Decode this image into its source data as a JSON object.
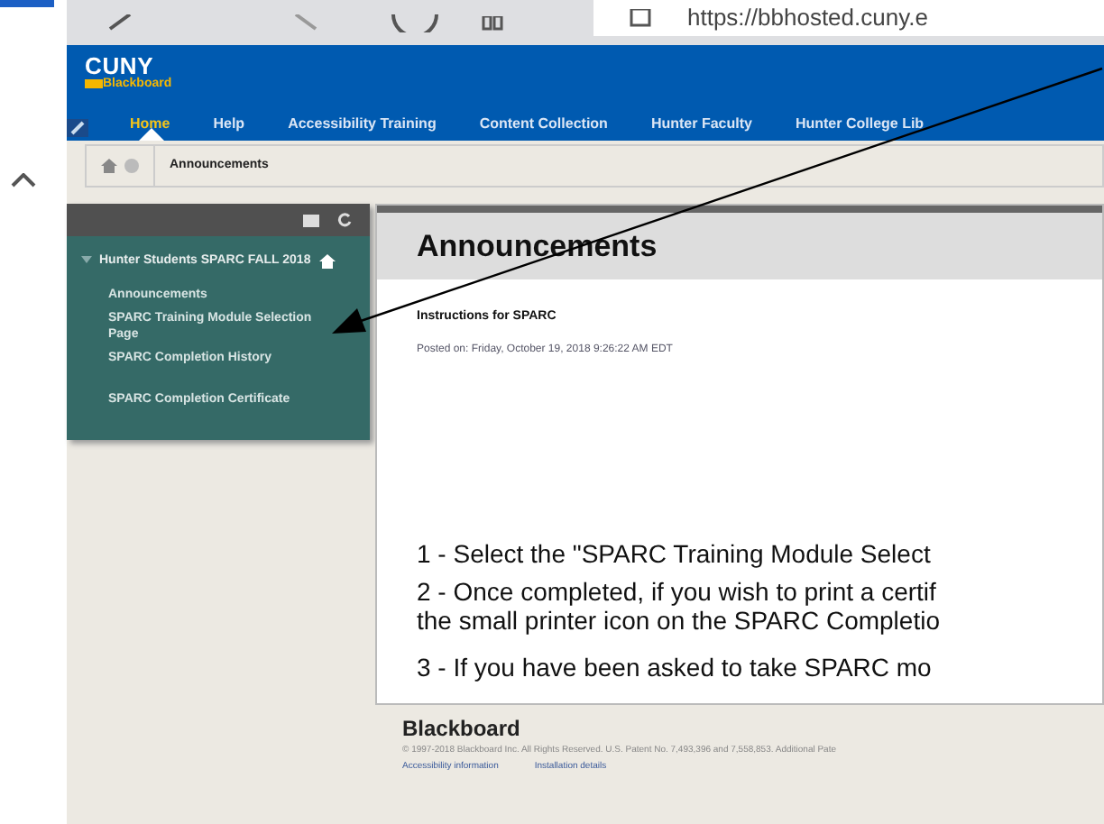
{
  "browser": {
    "address": "https://bbhosted.cuny.e"
  },
  "header": {
    "logo_top": "CUNY",
    "logo_bottom": "Blackboard",
    "nav": [
      {
        "label": "Home",
        "selected": true
      },
      {
        "label": "Help",
        "selected": false
      },
      {
        "label": "Accessibility Training",
        "selected": false
      },
      {
        "label": "Content Collection",
        "selected": false
      },
      {
        "label": "Hunter Faculty",
        "selected": false
      },
      {
        "label": "Hunter College Lib",
        "selected": false
      }
    ]
  },
  "breadcrumb": "Announcements",
  "sidebar": {
    "course": "Hunter Students SPARC FALL 2018",
    "expanded": true,
    "items": [
      {
        "label": "Announcements"
      },
      {
        "label": "SPARC Training Module Selection Page"
      },
      {
        "label": "SPARC Completion History"
      },
      {
        "label": "SPARC Completion Certificate"
      }
    ]
  },
  "content": {
    "title": "Announcements",
    "announcement_title": "Instructions for SPARC",
    "posted": "Posted on: Friday, October 19, 2018 9:26:22 AM EDT",
    "lines": [
      "1 - Select the \"SPARC Training Module Select",
      "2 - Once completed, if you wish to print a certif",
      "the small printer icon on the SPARC Completio",
      "3 - If you have been asked to take SPARC mo"
    ]
  },
  "footer": {
    "brand": "Blackboard",
    "copyright": "© 1997-2018 Blackboard Inc. All Rights Reserved. U.S. Patent No. 7,493,396 and 7,558,853. Additional Pate",
    "links": [
      "Accessibility information",
      "Installation details"
    ]
  }
}
